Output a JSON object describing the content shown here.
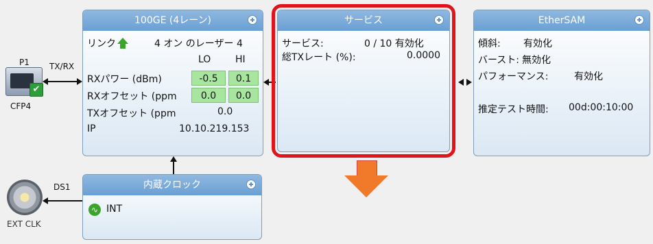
{
  "port": {
    "name": "P1",
    "type": "CFP4",
    "txrx": "TX/RX"
  },
  "ds1": {
    "label": "DS1",
    "ext": "EXT CLK"
  },
  "ge": {
    "title": "100GE (4レーン)",
    "link_label": "リンク",
    "lasers": "4 オン のレーザー 4",
    "lo": "LO",
    "hi": "HI",
    "rx_power_label": "RXパワー (dBm)",
    "rx_power_lo": "-0.5",
    "rx_power_hi": "0.1",
    "rx_offset_label": "RXオフセット (ppm",
    "rx_offset_lo": "0.0",
    "rx_offset_hi": "0.0",
    "tx_offset_label": "TXオフセット (ppm",
    "tx_offset_val": "0.0",
    "ip_label": "IP",
    "ip_val": "10.10.219.153"
  },
  "service": {
    "title": "サービス",
    "services_label": "サービス:",
    "services_val": "0 / 10 有効化",
    "txrate_label": "総TXレート (%):",
    "txrate_val": "0.0000"
  },
  "ethersam": {
    "title": "EtherSAM",
    "slope_label": "傾斜:",
    "slope_val": "有効化",
    "burst_label": "バースト:",
    "burst_val": "無効化",
    "perf_label": "パフォーマンス:",
    "perf_val": "有効化",
    "est_label": "推定テスト時間:",
    "est_val": "00d:00:10:00"
  },
  "clock": {
    "title": "内蔵クロック",
    "val": "INT"
  },
  "colors": {
    "highlight": "#e0141a",
    "arrow": "#f07a2a"
  }
}
